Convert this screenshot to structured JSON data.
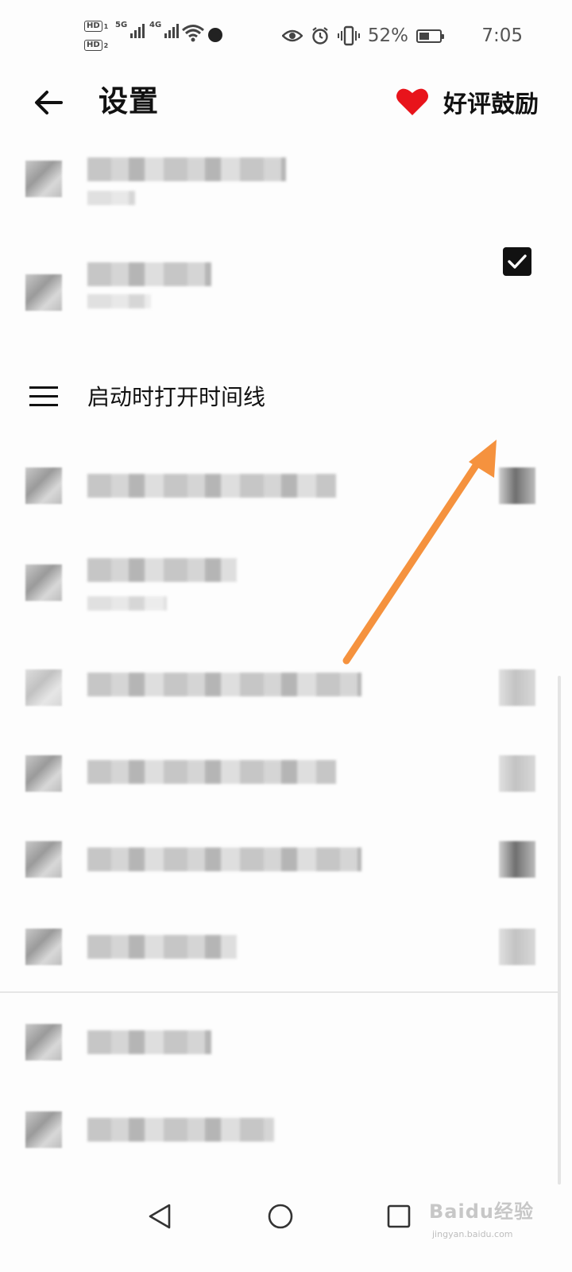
{
  "status_bar": {
    "sim1_label": "HD",
    "sim1_index": "1",
    "sim2_label": "HD",
    "sim2_index": "2",
    "network1": "5G",
    "network2": "4G",
    "battery_percent": "52%",
    "battery_level": 0.52,
    "time": "7:05",
    "icons": [
      "eye-icon",
      "alarm-icon",
      "vibrate-icon",
      "battery-icon",
      "wifi-icon",
      "signal-icon"
    ]
  },
  "header": {
    "back_icon": "arrow-left-icon",
    "title": "设置",
    "rate_label": "好评鼓励",
    "rate_icon": "heart-icon",
    "heart_color": "#e8141b"
  },
  "settings": {
    "timeline_item": {
      "label": "启动时打开时间线",
      "icon": "menu-icon",
      "checked": true
    }
  },
  "annotation": {
    "arrow_color": "#f5923e"
  },
  "nav_bar": {
    "icons": [
      "back-triangle-icon",
      "home-circle-icon",
      "recent-square-icon"
    ]
  },
  "watermark": {
    "brand": "Baidu经验",
    "url": "jingyan.baidu.com"
  }
}
